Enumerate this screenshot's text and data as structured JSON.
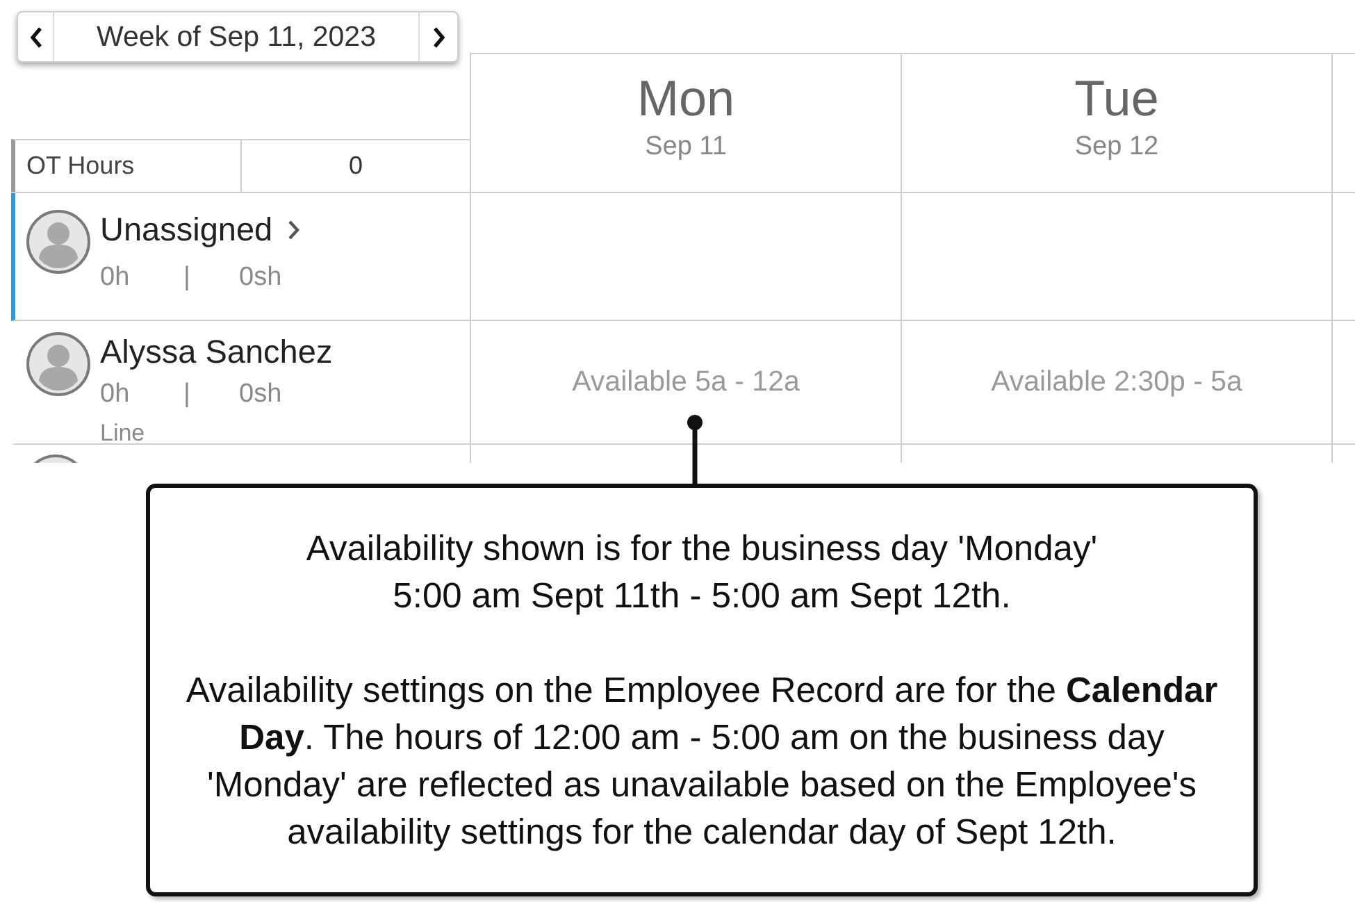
{
  "week_nav": {
    "label": "Week of Sep 11, 2023"
  },
  "day_columns": [
    {
      "day": "Mon",
      "date": "Sep 11"
    },
    {
      "day": "Tue",
      "date": "Sep 12"
    }
  ],
  "summary_row": {
    "label": "OT Hours",
    "value": "0"
  },
  "employees": [
    {
      "name": "Unassigned",
      "hours": "0h",
      "separator": "|",
      "shifts": "0sh",
      "selected": true,
      "expandable": true
    },
    {
      "name": "Alyssa Sanchez",
      "hours": "0h",
      "separator": "|",
      "shifts": "0sh",
      "role": "Line",
      "selected": false,
      "expandable": false,
      "availability": [
        "Available 5a - 12a",
        "Available 2:30p - 5a"
      ]
    }
  ],
  "callout": {
    "paragraphs": [
      "Availability shown is for the business day 'Monday'\n5:00 am Sept 11th - 5:00 am Sept 12th.",
      "Availability settings on the Employee Record are for the **Calendar**\n**Day**. The hours of 12:00 am - 5:00 am on the business day\n'Monday' are reflected as unavailable based on the Employee's\navailability settings for the calendar day of Sept 12th."
    ]
  }
}
